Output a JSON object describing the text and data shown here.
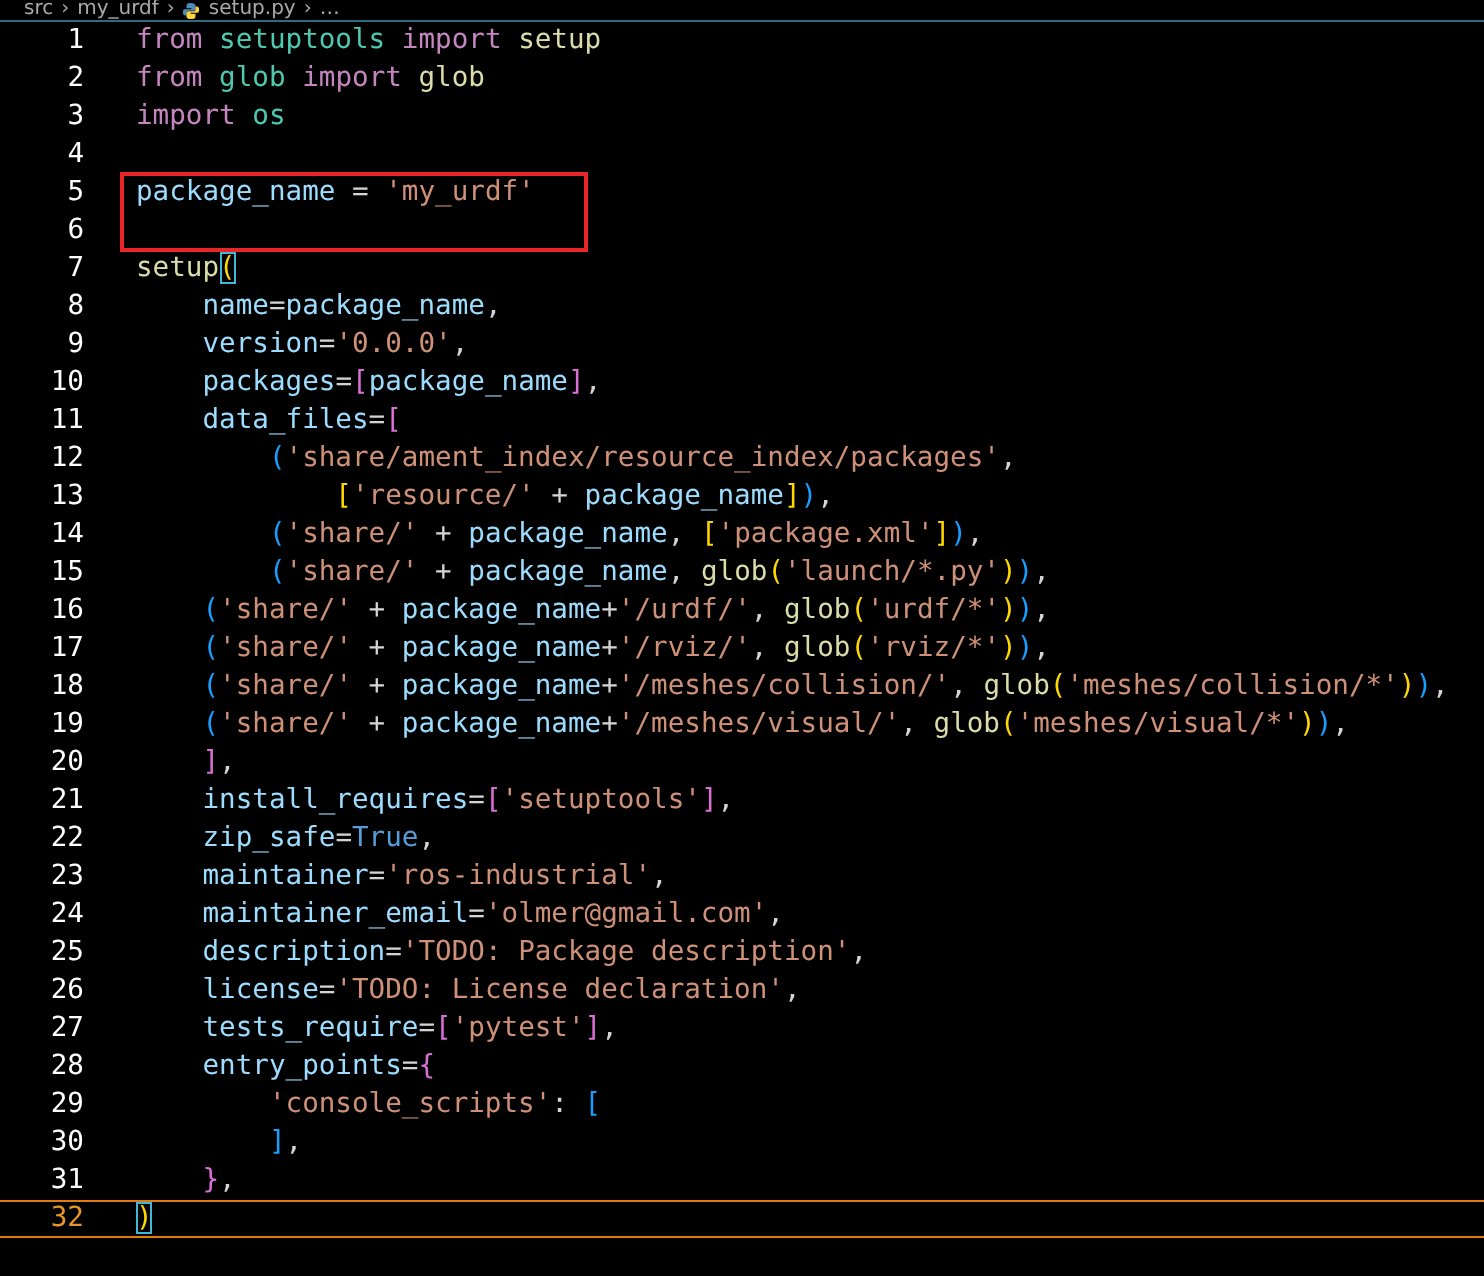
{
  "breadcrumb": [
    {
      "label": "src",
      "kind": "folder"
    },
    {
      "label": "my_urdf",
      "kind": "folder"
    },
    {
      "label": "setup.py",
      "kind": "file"
    },
    {
      "label": "…",
      "kind": "more"
    }
  ],
  "breadcrumb_separator": "›",
  "lines": [
    {
      "number": "1",
      "boxed": false,
      "current": false,
      "tokens": [
        {
          "text": "from",
          "kind": "keyword"
        },
        {
          "text": " setuptools",
          "kind": "module"
        },
        {
          "text": " import",
          "kind": "keyword"
        },
        {
          "text": " setup",
          "kind": "function"
        }
      ]
    },
    {
      "number": "2",
      "boxed": false,
      "current": false,
      "tokens": [
        {
          "text": "from",
          "kind": "keyword"
        },
        {
          "text": " glob",
          "kind": "module"
        },
        {
          "text": " import",
          "kind": "keyword"
        },
        {
          "text": " glob",
          "kind": "function"
        }
      ]
    },
    {
      "number": "3",
      "boxed": false,
      "current": false,
      "tokens": [
        {
          "text": "import",
          "kind": "keyword"
        },
        {
          "text": " os",
          "kind": "module"
        }
      ]
    },
    {
      "number": "4",
      "boxed": false,
      "current": false
    },
    {
      "number": "5",
      "boxed": true,
      "current": false,
      "tokens": [
        {
          "text": "package_name",
          "kind": "variable"
        },
        {
          "text": " = ",
          "kind": "punct"
        },
        {
          "text": "'my_urdf'",
          "kind": "string"
        }
      ]
    },
    {
      "number": "6",
      "boxed": true,
      "current": false
    },
    {
      "number": "7",
      "boxed": false,
      "current": false,
      "tokens": [
        {
          "text": "setup",
          "kind": "function"
        },
        {
          "text": "(",
          "kind": "matched"
        }
      ]
    },
    {
      "number": "8",
      "boxed": false,
      "current": false,
      "tokens": [
        {
          "text": "    name",
          "kind": "variable"
        },
        {
          "text": "=",
          "kind": "punct"
        },
        {
          "text": "package_name",
          "kind": "variable"
        },
        {
          "text": ",",
          "kind": "punct"
        }
      ]
    },
    {
      "number": "9",
      "boxed": false,
      "current": false,
      "tokens": [
        {
          "text": "    version",
          "kind": "variable"
        },
        {
          "text": "=",
          "kind": "punct"
        },
        {
          "text": "'0.0.0'",
          "kind": "string"
        },
        {
          "text": ",",
          "kind": "punct"
        }
      ]
    },
    {
      "number": "10",
      "boxed": false,
      "current": false,
      "tokens": [
        {
          "text": "    packages",
          "kind": "variable"
        },
        {
          "text": "=",
          "kind": "punct"
        },
        {
          "text": "[",
          "kind": "bracket2"
        },
        {
          "text": "package_name",
          "kind": "variable"
        },
        {
          "text": "]",
          "kind": "bracket2"
        },
        {
          "text": ",",
          "kind": "punct"
        }
      ]
    },
    {
      "number": "11",
      "boxed": false,
      "current": false,
      "tokens": [
        {
          "text": "    data_files",
          "kind": "variable"
        },
        {
          "text": "=",
          "kind": "punct"
        },
        {
          "text": "[",
          "kind": "bracket2"
        }
      ]
    },
    {
      "number": "12",
      "boxed": false,
      "current": false,
      "tokens": [
        {
          "text": "        (",
          "kind": "bracket3"
        },
        {
          "text": "'share/ament_index/resource_index/packages'",
          "kind": "string"
        },
        {
          "text": ",",
          "kind": "punct"
        }
      ]
    },
    {
      "number": "13",
      "boxed": false,
      "current": false,
      "tokens": [
        {
          "text": "            [",
          "kind": "bracket1"
        },
        {
          "text": "'resource/'",
          "kind": "string"
        },
        {
          "text": " + ",
          "kind": "punct"
        },
        {
          "text": "package_name",
          "kind": "variable"
        },
        {
          "text": "]",
          "kind": "bracket1"
        },
        {
          "text": ")",
          "kind": "bracket3"
        },
        {
          "text": ",",
          "kind": "punct"
        }
      ]
    },
    {
      "number": "14",
      "boxed": false,
      "current": false,
      "tokens": [
        {
          "text": "        (",
          "kind": "bracket3"
        },
        {
          "text": "'share/'",
          "kind": "string"
        },
        {
          "text": " + ",
          "kind": "punct"
        },
        {
          "text": "package_name",
          "kind": "variable"
        },
        {
          "text": ", ",
          "kind": "punct"
        },
        {
          "text": "[",
          "kind": "bracket1"
        },
        {
          "text": "'package.xml'",
          "kind": "string"
        },
        {
          "text": "]",
          "kind": "bracket1"
        },
        {
          "text": ")",
          "kind": "bracket3"
        },
        {
          "text": ",",
          "kind": "punct"
        }
      ]
    },
    {
      "number": "15",
      "boxed": false,
      "current": false,
      "tokens": [
        {
          "text": "        (",
          "kind": "bracket3"
        },
        {
          "text": "'share/'",
          "kind": "string"
        },
        {
          "text": " + ",
          "kind": "punct"
        },
        {
          "text": "package_name",
          "kind": "variable"
        },
        {
          "text": ", ",
          "kind": "punct"
        },
        {
          "text": "glob",
          "kind": "function"
        },
        {
          "text": "(",
          "kind": "bracket1"
        },
        {
          "text": "'launch/*.py'",
          "kind": "string"
        },
        {
          "text": ")",
          "kind": "bracket1"
        },
        {
          "text": ")",
          "kind": "bracket3"
        },
        {
          "text": ",",
          "kind": "punct"
        }
      ]
    },
    {
      "number": "16",
      "boxed": false,
      "current": false,
      "tokens": [
        {
          "text": "    (",
          "kind": "bracket3"
        },
        {
          "text": "'share/'",
          "kind": "string"
        },
        {
          "text": " + ",
          "kind": "punct"
        },
        {
          "text": "package_name",
          "kind": "variable"
        },
        {
          "text": "+",
          "kind": "punct"
        },
        {
          "text": "'/urdf/'",
          "kind": "string"
        },
        {
          "text": ", ",
          "kind": "punct"
        },
        {
          "text": "glob",
          "kind": "function"
        },
        {
          "text": "(",
          "kind": "bracket1"
        },
        {
          "text": "'urdf/*'",
          "kind": "string"
        },
        {
          "text": ")",
          "kind": "bracket1"
        },
        {
          "text": ")",
          "kind": "bracket3"
        },
        {
          "text": ",",
          "kind": "punct"
        }
      ]
    },
    {
      "number": "17",
      "boxed": false,
      "current": false,
      "tokens": [
        {
          "text": "    (",
          "kind": "bracket3"
        },
        {
          "text": "'share/'",
          "kind": "string"
        },
        {
          "text": " + ",
          "kind": "punct"
        },
        {
          "text": "package_name",
          "kind": "variable"
        },
        {
          "text": "+",
          "kind": "punct"
        },
        {
          "text": "'/rviz/'",
          "kind": "string"
        },
        {
          "text": ", ",
          "kind": "punct"
        },
        {
          "text": "glob",
          "kind": "function"
        },
        {
          "text": "(",
          "kind": "bracket1"
        },
        {
          "text": "'rviz/*'",
          "kind": "string"
        },
        {
          "text": ")",
          "kind": "bracket1"
        },
        {
          "text": ")",
          "kind": "bracket3"
        },
        {
          "text": ",",
          "kind": "punct"
        }
      ]
    },
    {
      "number": "18",
      "boxed": false,
      "current": false,
      "tokens": [
        {
          "text": "    (",
          "kind": "bracket3"
        },
        {
          "text": "'share/'",
          "kind": "string"
        },
        {
          "text": " + ",
          "kind": "punct"
        },
        {
          "text": "package_name",
          "kind": "variable"
        },
        {
          "text": "+",
          "kind": "punct"
        },
        {
          "text": "'/meshes/collision/'",
          "kind": "string"
        },
        {
          "text": ", ",
          "kind": "punct"
        },
        {
          "text": "glob",
          "kind": "function"
        },
        {
          "text": "(",
          "kind": "bracket1"
        },
        {
          "text": "'meshes/collision/*'",
          "kind": "string"
        },
        {
          "text": ")",
          "kind": "bracket1"
        },
        {
          "text": ")",
          "kind": "bracket3"
        },
        {
          "text": ",",
          "kind": "punct"
        }
      ]
    },
    {
      "number": "19",
      "boxed": false,
      "current": false,
      "tokens": [
        {
          "text": "    (",
          "kind": "bracket3"
        },
        {
          "text": "'share/'",
          "kind": "string"
        },
        {
          "text": " + ",
          "kind": "punct"
        },
        {
          "text": "package_name",
          "kind": "variable"
        },
        {
          "text": "+",
          "kind": "punct"
        },
        {
          "text": "'/meshes/visual/'",
          "kind": "string"
        },
        {
          "text": ", ",
          "kind": "punct"
        },
        {
          "text": "glob",
          "kind": "function"
        },
        {
          "text": "(",
          "kind": "bracket1"
        },
        {
          "text": "'meshes/visual/*'",
          "kind": "string"
        },
        {
          "text": ")",
          "kind": "bracket1"
        },
        {
          "text": ")",
          "kind": "bracket3"
        },
        {
          "text": ",",
          "kind": "punct"
        }
      ]
    },
    {
      "number": "20",
      "boxed": false,
      "current": false,
      "tokens": [
        {
          "text": "    ]",
          "kind": "bracket2"
        },
        {
          "text": ",",
          "kind": "punct"
        }
      ]
    },
    {
      "number": "21",
      "boxed": false,
      "current": false,
      "tokens": [
        {
          "text": "    install_requires",
          "kind": "variable"
        },
        {
          "text": "=",
          "kind": "punct"
        },
        {
          "text": "[",
          "kind": "bracket2"
        },
        {
          "text": "'setuptools'",
          "kind": "string"
        },
        {
          "text": "]",
          "kind": "bracket2"
        },
        {
          "text": ",",
          "kind": "punct"
        }
      ]
    },
    {
      "number": "22",
      "boxed": false,
      "current": false,
      "tokens": [
        {
          "text": "    zip_safe",
          "kind": "variable"
        },
        {
          "text": "=",
          "kind": "punct"
        },
        {
          "text": "True",
          "kind": "constant"
        },
        {
          "text": ",",
          "kind": "punct"
        }
      ]
    },
    {
      "number": "23",
      "boxed": false,
      "current": false,
      "tokens": [
        {
          "text": "    maintainer",
          "kind": "variable"
        },
        {
          "text": "=",
          "kind": "punct"
        },
        {
          "text": "'ros-industrial'",
          "kind": "string"
        },
        {
          "text": ",",
          "kind": "punct"
        }
      ]
    },
    {
      "number": "24",
      "boxed": false,
      "current": false,
      "tokens": [
        {
          "text": "    maintainer_email",
          "kind": "variable"
        },
        {
          "text": "=",
          "kind": "punct"
        },
        {
          "text": "'olmer@gmail.com'",
          "kind": "string"
        },
        {
          "text": ",",
          "kind": "punct"
        }
      ]
    },
    {
      "number": "25",
      "boxed": false,
      "current": false,
      "tokens": [
        {
          "text": "    description",
          "kind": "variable"
        },
        {
          "text": "=",
          "kind": "punct"
        },
        {
          "text": "'TODO: Package description'",
          "kind": "string"
        },
        {
          "text": ",",
          "kind": "punct"
        }
      ]
    },
    {
      "number": "26",
      "boxed": false,
      "current": false,
      "tokens": [
        {
          "text": "    license",
          "kind": "variable"
        },
        {
          "text": "=",
          "kind": "punct"
        },
        {
          "text": "'TODO: License declaration'",
          "kind": "string"
        },
        {
          "text": ",",
          "kind": "punct"
        }
      ]
    },
    {
      "number": "27",
      "boxed": false,
      "current": false,
      "tokens": [
        {
          "text": "    tests_require",
          "kind": "variable"
        },
        {
          "text": "=",
          "kind": "punct"
        },
        {
          "text": "[",
          "kind": "bracket2"
        },
        {
          "text": "'pytest'",
          "kind": "string"
        },
        {
          "text": "]",
          "kind": "bracket2"
        },
        {
          "text": ",",
          "kind": "punct"
        }
      ]
    },
    {
      "number": "28",
      "boxed": false,
      "current": false,
      "tokens": [
        {
          "text": "    entry_points",
          "kind": "variable"
        },
        {
          "text": "=",
          "kind": "punct"
        },
        {
          "text": "{",
          "kind": "bracket2"
        }
      ]
    },
    {
      "number": "29",
      "boxed": false,
      "current": false,
      "tokens": [
        {
          "text": "        'console_scripts'",
          "kind": "string"
        },
        {
          "text": ": ",
          "kind": "punct"
        },
        {
          "text": "[",
          "kind": "bracket3"
        }
      ]
    },
    {
      "number": "30",
      "boxed": false,
      "current": false,
      "tokens": [
        {
          "text": "        ]",
          "kind": "bracket3"
        },
        {
          "text": ",",
          "kind": "punct"
        }
      ]
    },
    {
      "number": "31",
      "boxed": false,
      "current": false,
      "tokens": [
        {
          "text": "    }",
          "kind": "bracket2"
        },
        {
          "text": ",",
          "kind": "punct"
        }
      ]
    },
    {
      "number": "32",
      "boxed": false,
      "current": true,
      "tokens": [
        {
          "text": ")",
          "kind": "matched"
        }
      ]
    }
  ]
}
